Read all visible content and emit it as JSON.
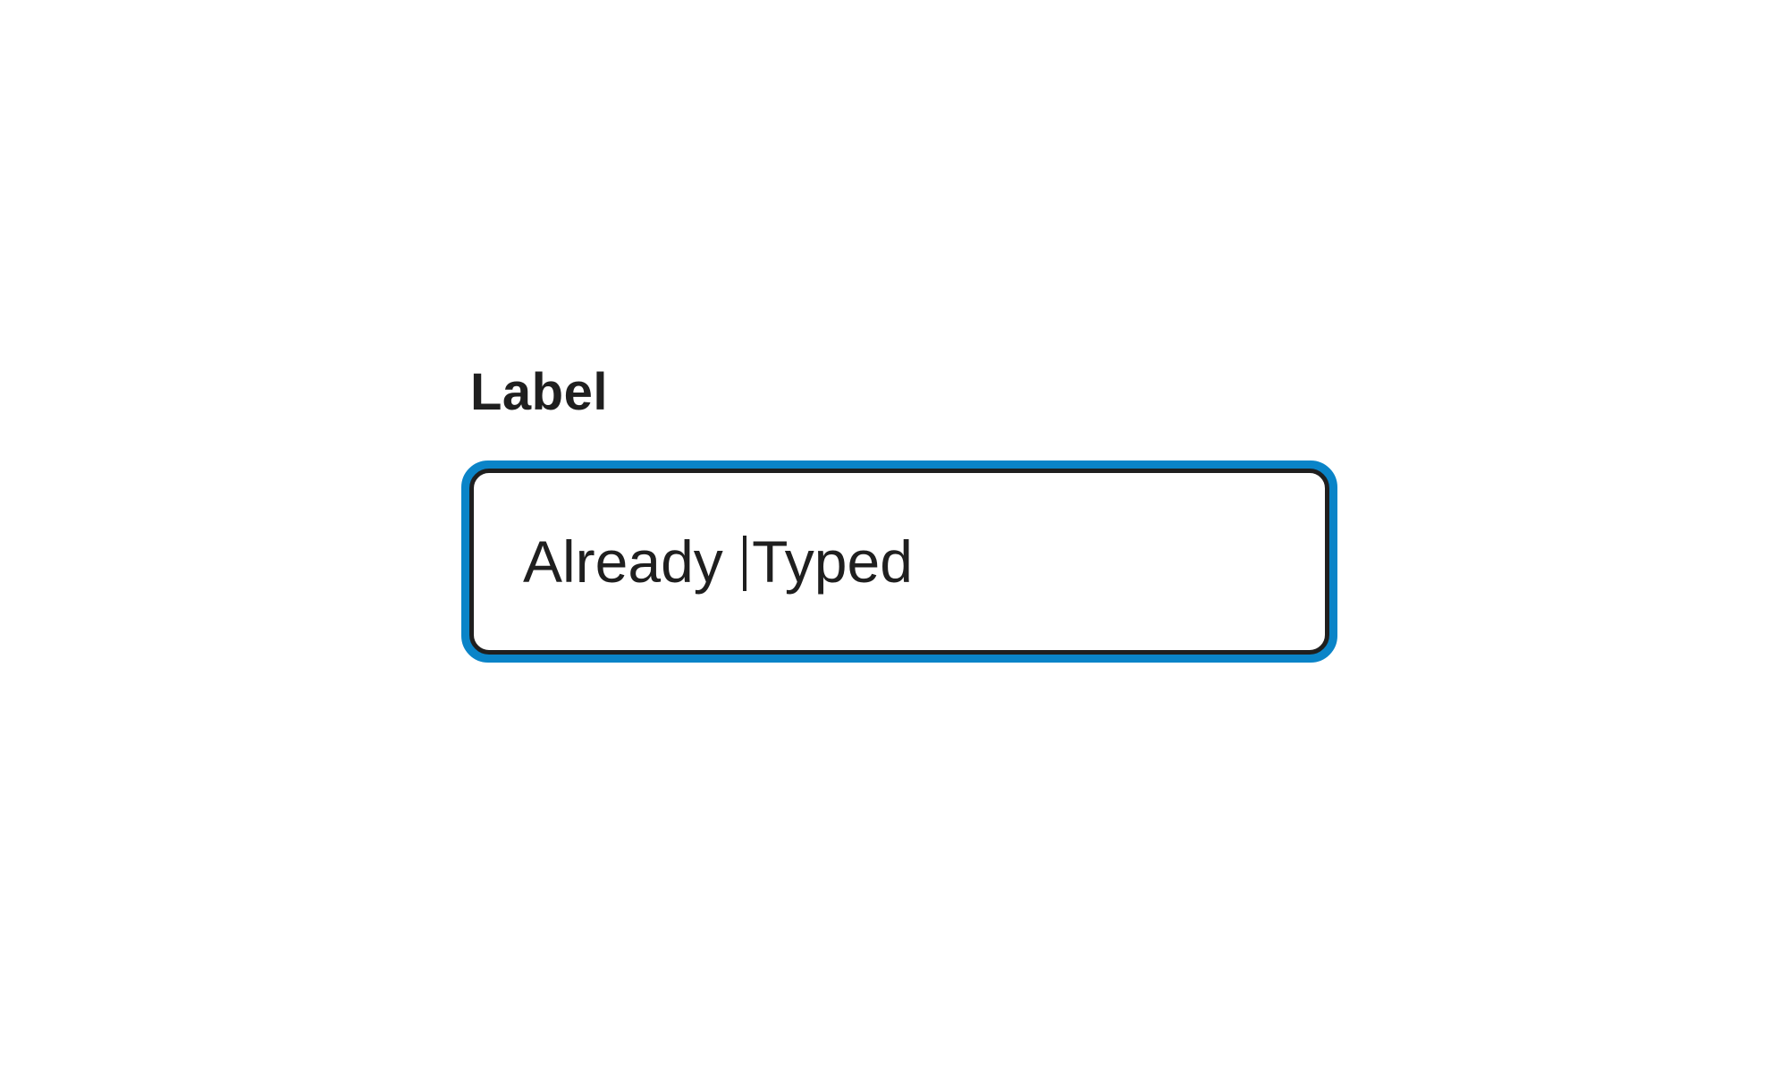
{
  "form": {
    "label": "Label",
    "input": {
      "value_before_caret": "Already ",
      "value_after_caret": "Typed",
      "focused": true
    }
  },
  "colors": {
    "focus_ring": "#0a84c8",
    "border": "#1f1f1f",
    "text": "#1f1f1f",
    "background": "#ffffff"
  }
}
